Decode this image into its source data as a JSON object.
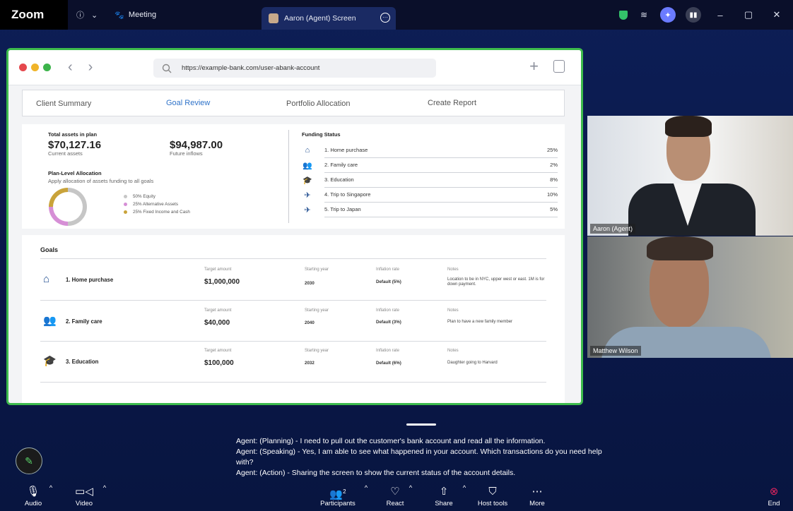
{
  "topbar": {
    "brand": "Zoom",
    "info_icon": "ⓘ",
    "chevron": "⌄",
    "meeting_label": "Meeting",
    "screen_tab_label": "Aaron (Agent) Screen",
    "window_min": "–",
    "window_max": "▢",
    "window_close": "✕"
  },
  "browser": {
    "url": "https://example-bank.com/user-abank-account",
    "back": "‹",
    "forward": "›",
    "new_tab": "+"
  },
  "tabs": [
    {
      "label": "Client Summary"
    },
    {
      "label": "Goal Review"
    },
    {
      "label": "Portfolio Allocation"
    },
    {
      "label": "Create Report"
    }
  ],
  "summary": {
    "total_assets_label": "Total assets in plan",
    "current_value": "$70,127.16",
    "current_label": "Current assets",
    "future_value": "$94,987.00",
    "future_label": "Future inflows",
    "allocation_title": "Plan-Level Allocation",
    "allocation_sub": "Apply allocation of assets funding to all goals",
    "legend": [
      {
        "text": "50%  Equity",
        "color": "#c6c6c6"
      },
      {
        "text": "25%  Alternative Assets",
        "color": "#d68fd6"
      },
      {
        "text": "25%  Fixed Income and Cash",
        "color": "#c9a33a"
      }
    ],
    "donut_shares": [
      50,
      25,
      25
    ]
  },
  "funding": {
    "title": "Funding Status",
    "rows": [
      {
        "icon": "home-icon",
        "glyph": "⌂",
        "label": "1. Home purchase",
        "pct": "25%"
      },
      {
        "icon": "family-icon",
        "glyph": "👥",
        "label": "2. Family care",
        "pct": "2%"
      },
      {
        "icon": "graduation-cap-icon",
        "glyph": "🎓",
        "label": "3. Education",
        "pct": "8%"
      },
      {
        "icon": "airplane-icon",
        "glyph": "✈",
        "label": "4. Trip to Singapore",
        "pct": "10%"
      },
      {
        "icon": "airplane-icon",
        "glyph": "✈",
        "label": "5. Trip to Japan",
        "pct": "5%"
      }
    ]
  },
  "goals": {
    "title": "Goals",
    "headers": {
      "target": "Target amount",
      "year": "Starting year",
      "inflation": "Inflation rate",
      "notes": "Notes"
    },
    "rows": [
      {
        "icon": "home-icon",
        "glyph": "⌂",
        "name": "1. Home purchase",
        "amount": "$1,000,000",
        "year": "2030",
        "inflation": "Default (5%)",
        "notes": "Location to be in NYC, upper west or east. 1M is for down payment."
      },
      {
        "icon": "family-icon",
        "glyph": "👥",
        "name": "2. Family care",
        "amount": "$40,000",
        "year": "2040",
        "inflation": "Default (3%)",
        "notes": "Plan to have a new family member"
      },
      {
        "icon": "graduation-cap-icon",
        "glyph": "🎓",
        "name": "3. Education",
        "amount": "$100,000",
        "year": "2032",
        "inflation": "Default (6%)",
        "notes": "Daughter going to Harvard"
      }
    ]
  },
  "participants": [
    {
      "name": "Aaron (Agent)"
    },
    {
      "name": "Matthew Wilson"
    }
  ],
  "transcript": [
    "Agent: (Planning) - I need to pull out the customer's bank account and read all the information.",
    "Agent: (Speaking) - Yes, I am able to see what happened in your account. Which transactions do you need help with?",
    "Agent: (Action) - Sharing the screen to show the current status of the account details."
  ],
  "toolbar": {
    "audio": "Audio",
    "video": "Video",
    "participants": "Participants",
    "participants_count": "2",
    "react": "React",
    "share": "Share",
    "host_tools": "Host tools",
    "more": "More",
    "end": "End",
    "caret": "^"
  },
  "colors": {
    "accent_green": "#3dbb4c",
    "link_blue": "#2f73c9",
    "end_red": "#e0245e"
  }
}
